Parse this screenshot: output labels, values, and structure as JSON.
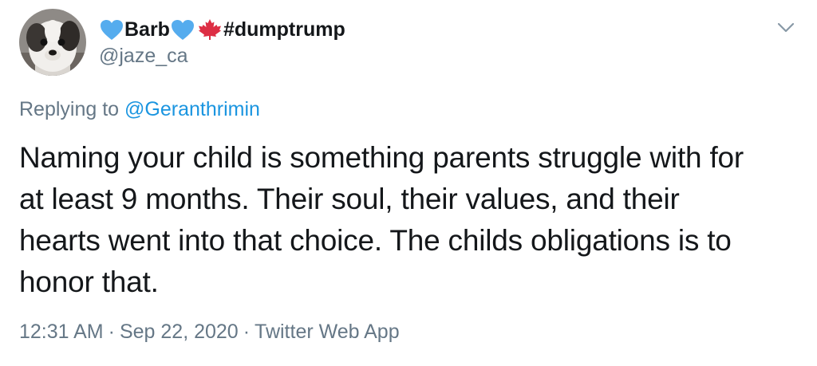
{
  "author": {
    "name_part1": "Barb",
    "name_part2": "#dumptrump",
    "name_emojis": [
      "blue-heart-icon",
      "blue-heart-icon",
      "maple-leaf-icon"
    ],
    "handle": "@jaze_ca",
    "avatar": "dog-avatar"
  },
  "reply": {
    "prefix": "Replying to",
    "mention": "@Geranthrimin"
  },
  "tweet": {
    "text": "Naming your child is something parents struggle with for\nat least 9 months.  Their soul, their values, and their\nhearts went into that choice.  The childs obligations is to\nhonor that."
  },
  "meta": {
    "time": "12:31 AM",
    "separator": "·",
    "date": "Sep 22, 2020",
    "source": "Twitter Web App"
  },
  "colors": {
    "text": "#14171a",
    "secondary": "#657786",
    "link": "#1b95e0",
    "heart": "#55acee",
    "leaf": "#dd2e44"
  },
  "icons": {
    "caret": "chevron-down-icon"
  }
}
